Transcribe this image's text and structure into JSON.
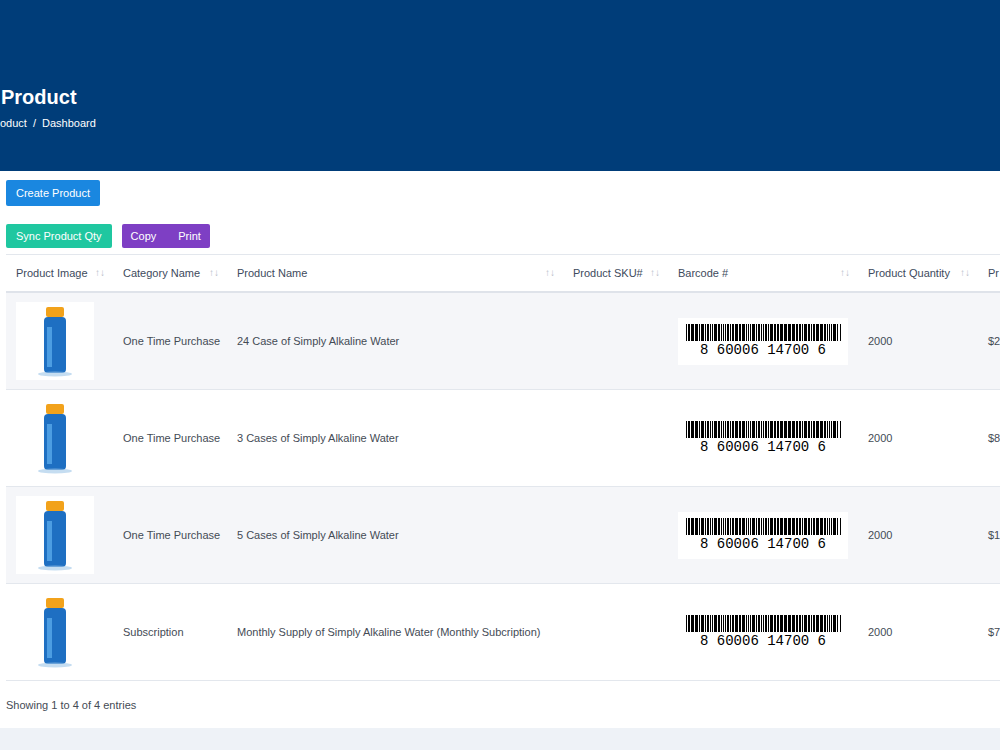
{
  "header": {
    "title": "Product",
    "breadcrumb": [
      "oduct",
      "Dashboard"
    ],
    "separator": "/"
  },
  "buttons": {
    "create": "Create Product",
    "sync": "Sync Product Qty",
    "copy": "Copy",
    "print": "Print"
  },
  "table": {
    "columns": [
      {
        "label": "Product Image",
        "sort": "↑↓"
      },
      {
        "label": "Category Name",
        "sort": "↑↓"
      },
      {
        "label": "Product Name",
        "sort": "↑↓"
      },
      {
        "label": "Product SKU#",
        "sort": "↑↓"
      },
      {
        "label": "Barcode #",
        "sort": "↑↓"
      },
      {
        "label": "Product Quantity",
        "sort": "↑↓"
      },
      {
        "label": "Pr",
        "sort": ""
      }
    ],
    "rows": [
      {
        "category": "One Time Purchase",
        "name": "24 Case of Simply Alkaline Water",
        "sku": "",
        "barcode": "8 60006 14700 6",
        "quantity": "2000",
        "price": "$2"
      },
      {
        "category": "One Time Purchase",
        "name": "3 Cases of Simply Alkaline Water",
        "sku": "",
        "barcode": "8 60006 14700 6",
        "quantity": "2000",
        "price": "$8"
      },
      {
        "category": "One Time Purchase",
        "name": "5 Cases of Simply Alkaline Water",
        "sku": "",
        "barcode": "8 60006 14700 6",
        "quantity": "2000",
        "price": "$1"
      },
      {
        "category": "Subscription",
        "name": "Monthly Supply of Simply Alkaline Water (Monthly Subcription)",
        "sku": "",
        "barcode": "8 60006 14700 6",
        "quantity": "2000",
        "price": "$7"
      }
    ]
  },
  "footer": "Showing 1 to 4 of 4 entries"
}
